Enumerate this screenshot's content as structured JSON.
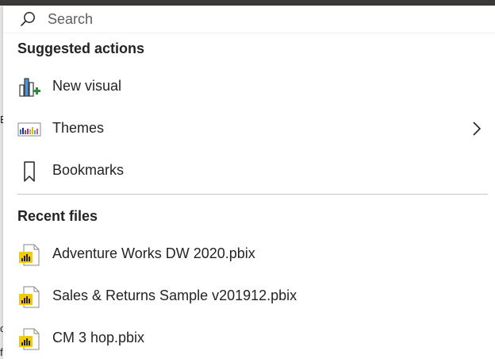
{
  "search": {
    "placeholder": "Search"
  },
  "suggested": {
    "title": "Suggested actions",
    "items": [
      {
        "label": "New visual",
        "icon": "new-visual-icon"
      },
      {
        "label": "Themes",
        "icon": "themes-icon"
      },
      {
        "label": "Bookmarks",
        "icon": "bookmark-icon"
      }
    ]
  },
  "recent": {
    "title": "Recent files",
    "items": [
      {
        "label": "Adventure Works DW 2020.pbix",
        "icon": "pbix-file-icon"
      },
      {
        "label": "Sales & Returns Sample v201912.pbix",
        "icon": "pbix-file-icon"
      },
      {
        "label": "CM 3 hop.pbix",
        "icon": "pbix-file-icon"
      }
    ]
  },
  "background": {
    "edge_letters": [
      "E",
      "c",
      "f"
    ]
  },
  "colors": {
    "accent": "#f2c811",
    "divider": "#c8c6c4",
    "text": "#252423"
  }
}
